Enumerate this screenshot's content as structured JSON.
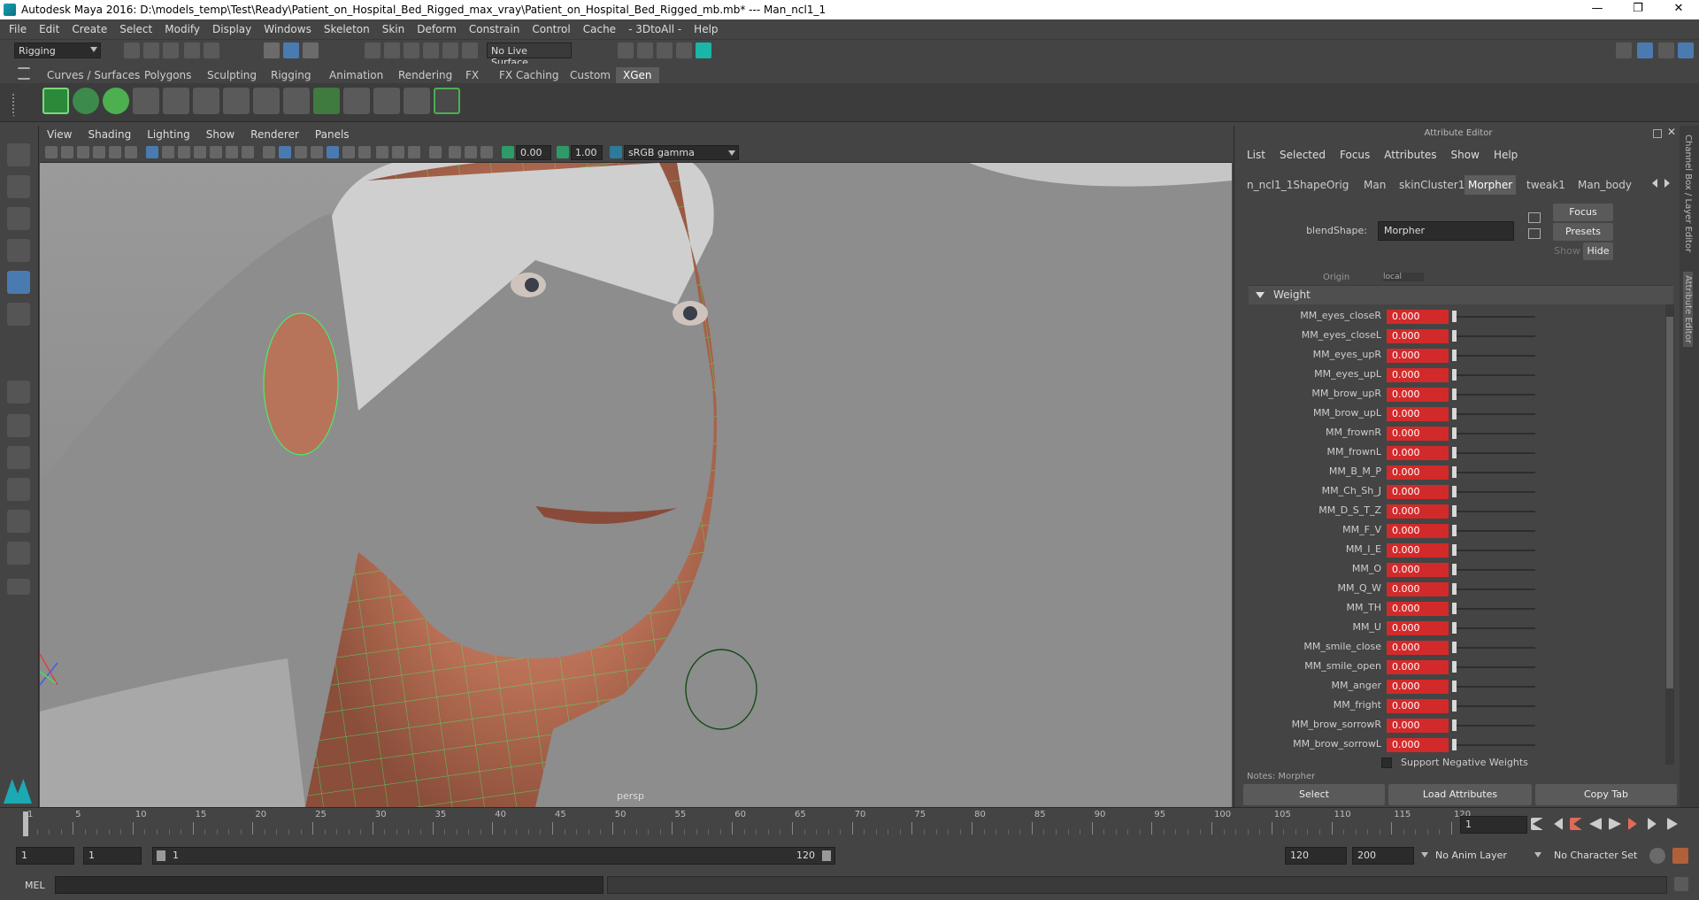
{
  "title": "Autodesk Maya 2016: D:\\models_temp\\Test\\Ready\\Patient_on_Hospital_Bed_Rigged_max_vray\\Patient_on_Hospital_Bed_Rigged_mb.mb*   ---   Man_ncl1_1",
  "window_controls": {
    "minimize": "—",
    "maximize": "❐",
    "close": "✕"
  },
  "menu": [
    "File",
    "Edit",
    "Create",
    "Select",
    "Modify",
    "Display",
    "Windows",
    "Skeleton",
    "Skin",
    "Deform",
    "Constrain",
    "Control",
    "Cache",
    "- 3DtoAll -",
    "Help"
  ],
  "status": {
    "menuset": "Rigging",
    "live_surface": "No Live Surface"
  },
  "shelf_tabs": [
    "Curves / Surfaces",
    "Polygons",
    "Sculpting",
    "Rigging",
    "Animation",
    "Rendering",
    "FX",
    "FX Caching",
    "Custom",
    "XGen"
  ],
  "viewport": {
    "menu": [
      "View",
      "Shading",
      "Lighting",
      "Show",
      "Renderer",
      "Panels"
    ],
    "exposure": "0.00",
    "gamma": "1.00",
    "colorspace": "sRGB gamma",
    "camera_label": "persp"
  },
  "attribute_editor": {
    "header": "Attribute Editor",
    "menu": [
      "List",
      "Selected",
      "Focus",
      "Attributes",
      "Show",
      "Help"
    ],
    "tabs": [
      "n_ncl1_1ShapeOrig",
      "Man",
      "skinCluster1",
      "Morpher",
      "tweak1",
      "Man_body"
    ],
    "blend_label": "blendShape:",
    "blend_value": "Morpher",
    "focus_btn": "Focus",
    "presets_btn": "Presets",
    "show_btn": "Show",
    "hide_btn": "Hide",
    "origin_partial": "Origin",
    "origin_value": "local",
    "section": "Weight",
    "weights": [
      {
        "name": "MM_eyes_closeR",
        "value": "0.000"
      },
      {
        "name": "MM_eyes_closeL",
        "value": "0.000"
      },
      {
        "name": "MM_eyes_upR",
        "value": "0.000"
      },
      {
        "name": "MM_eyes_upL",
        "value": "0.000"
      },
      {
        "name": "MM_brow_upR",
        "value": "0.000"
      },
      {
        "name": "MM_brow_upL",
        "value": "0.000"
      },
      {
        "name": "MM_frownR",
        "value": "0.000"
      },
      {
        "name": "MM_frownL",
        "value": "0.000"
      },
      {
        "name": "MM_B_M_P",
        "value": "0.000"
      },
      {
        "name": "MM_Ch_Sh_J",
        "value": "0.000"
      },
      {
        "name": "MM_D_S_T_Z",
        "value": "0.000"
      },
      {
        "name": "MM_F_V",
        "value": "0.000"
      },
      {
        "name": "MM_I_E",
        "value": "0.000"
      },
      {
        "name": "MM_O",
        "value": "0.000"
      },
      {
        "name": "MM_Q_W",
        "value": "0.000"
      },
      {
        "name": "MM_TH",
        "value": "0.000"
      },
      {
        "name": "MM_U",
        "value": "0.000"
      },
      {
        "name": "MM_smile_close",
        "value": "0.000"
      },
      {
        "name": "MM_smile_open",
        "value": "0.000"
      },
      {
        "name": "MM_anger",
        "value": "0.000"
      },
      {
        "name": "MM_fright",
        "value": "0.000"
      },
      {
        "name": "MM_brow_sorrowR",
        "value": "0.000"
      },
      {
        "name": "MM_brow_sorrowL",
        "value": "0.000"
      }
    ],
    "support_negative": "Support Negative Weights",
    "notes": "Notes: Morpher",
    "buttons": {
      "select": "Select",
      "load": "Load Attributes",
      "copy": "Copy Tab"
    }
  },
  "side_tabs": [
    "Channel Box / Layer Editor",
    "Attribute Editor"
  ],
  "timeline": {
    "ticks": [
      "1",
      "5",
      "10",
      "15",
      "20",
      "25",
      "30",
      "35",
      "40",
      "45",
      "50",
      "55",
      "60",
      "65",
      "70",
      "75",
      "80",
      "85",
      "90",
      "95",
      "100",
      "105",
      "110",
      "115",
      "120"
    ],
    "current_frame": "1"
  },
  "range": {
    "start": "1",
    "playback_start": "1",
    "slider_start": "1",
    "slider_end": "120",
    "playback_end": "120",
    "end": "200",
    "anim_layer": "No Anim Layer",
    "char_set": "No Character Set"
  },
  "command_line": {
    "label": "MEL"
  }
}
